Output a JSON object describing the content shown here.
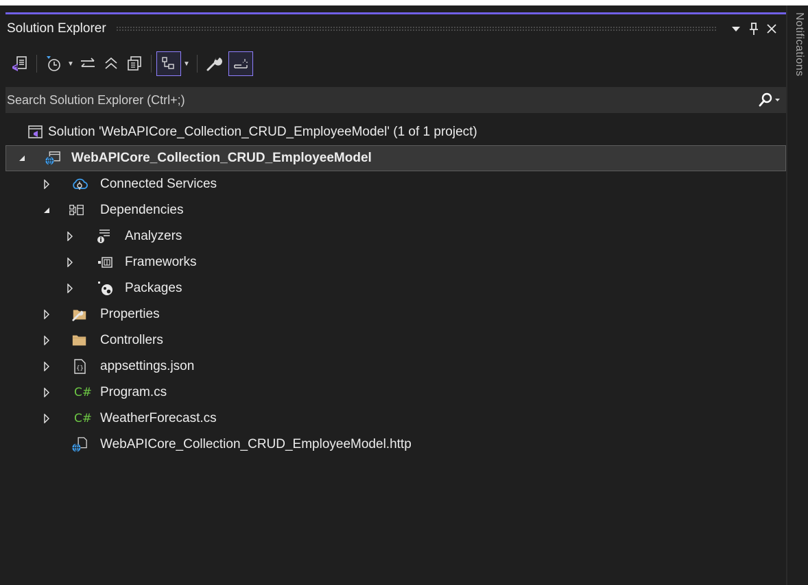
{
  "window": {
    "title": "Solution Explorer",
    "side_tab": "Notifications"
  },
  "title_buttons": [
    {
      "icon": "dropdown-arrow-icon",
      "glyph": "▼"
    },
    {
      "icon": "pin-icon",
      "glyph": "Ⅱ"
    },
    {
      "icon": "close-icon",
      "glyph": "✕"
    }
  ],
  "search": {
    "placeholder": "Search Solution Explorer (Ctrl+;)",
    "value": ""
  },
  "toolbar": [
    {
      "icon": "switch-views-icon"
    },
    {
      "icon": "pending-changes-filter-icon",
      "caret": true
    },
    {
      "icon": "sync-with-active-document-icon"
    },
    {
      "icon": "collapse-all-icon"
    },
    {
      "icon": "show-all-files-icon"
    },
    {
      "icon": "preview-selected-items-icon",
      "selected": true,
      "caret": true
    },
    {
      "icon": "properties-wrench-icon"
    },
    {
      "icon": "toggle-preview-icon",
      "selected": true
    }
  ],
  "tree": [
    {
      "label": "Solution 'WebAPICore_Collection_CRUD_EmployeeModel' (1 of 1 project)",
      "icon": "solution-icon",
      "expander": "none"
    },
    {
      "label": "WebAPICore_Collection_CRUD_EmployeeModel",
      "icon": "web-project-icon",
      "expander": "expanded",
      "bold": true,
      "selected": true
    },
    {
      "label": "Connected Services",
      "icon": "connected-services-icon",
      "expander": "collapsed"
    },
    {
      "label": "Dependencies",
      "icon": "dependencies-icon",
      "expander": "expanded"
    },
    {
      "label": "Analyzers",
      "icon": "analyzers-icon",
      "expander": "collapsed"
    },
    {
      "label": "Frameworks",
      "icon": "frameworks-icon",
      "expander": "collapsed"
    },
    {
      "label": "Packages",
      "icon": "packages-icon",
      "expander": "collapsed"
    },
    {
      "label": "Properties",
      "icon": "properties-folder-icon",
      "expander": "collapsed"
    },
    {
      "label": "Controllers",
      "icon": "folder-icon",
      "expander": "collapsed"
    },
    {
      "label": "appsettings.json",
      "icon": "json-file-icon",
      "expander": "collapsed"
    },
    {
      "label": "Program.cs",
      "icon": "csharp-file-icon",
      "expander": "collapsed",
      "badge": "C#"
    },
    {
      "label": "WeatherForecast.cs",
      "icon": "csharp-file-icon",
      "expander": "collapsed",
      "badge": "C#"
    },
    {
      "label": "WebAPICore_Collection_CRUD_EmployeeModel.http",
      "icon": "http-file-icon",
      "expander": "none"
    }
  ],
  "colors": {
    "accent": "#7160e8",
    "csharp_green": "#6cc644",
    "folder_tan": "#dcb67a",
    "link_blue": "#3e9ff0"
  }
}
